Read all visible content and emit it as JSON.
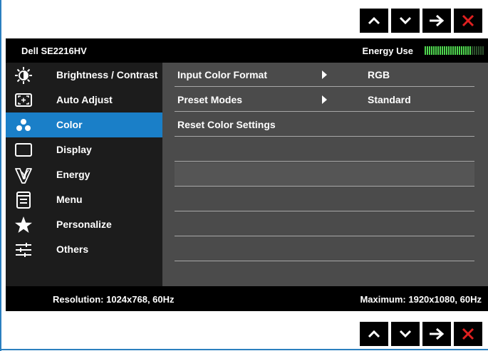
{
  "nav_buttons": {
    "up": "up-arrow-icon",
    "down": "down-arrow-icon",
    "enter": "right-arrow-icon",
    "exit": "close-icon",
    "exit_color": "#e02020"
  },
  "osd": {
    "model": "Dell SE2216HV",
    "energy_label": "Energy Use",
    "energy_level": 0.8,
    "energy_color": "#4fd64f",
    "energy_off_color": "#2c4f2c",
    "accent": "#1a7fc8",
    "menu": [
      {
        "label": "Brightness / Contrast",
        "icon": "brightness-icon"
      },
      {
        "label": "Auto Adjust",
        "icon": "auto-adjust-icon"
      },
      {
        "label": "Color",
        "icon": "color-icon",
        "active": true
      },
      {
        "label": "Display",
        "icon": "display-icon"
      },
      {
        "label": "Energy",
        "icon": "energy-icon"
      },
      {
        "label": "Menu",
        "icon": "menu-icon"
      },
      {
        "label": "Personalize",
        "icon": "star-icon"
      },
      {
        "label": "Others",
        "icon": "sliders-icon"
      }
    ],
    "options": [
      {
        "label": "Input Color Format",
        "value": "RGB",
        "has_submenu": true
      },
      {
        "label": "Preset Modes",
        "value": "Standard",
        "has_submenu": true
      },
      {
        "label": "Reset Color Settings",
        "value": "",
        "has_submenu": false
      },
      {
        "label": "",
        "value": "",
        "has_submenu": false
      },
      {
        "label": "",
        "value": "",
        "has_submenu": false
      },
      {
        "label": "",
        "value": "",
        "has_submenu": false
      },
      {
        "label": "",
        "value": "",
        "has_submenu": false
      },
      {
        "label": "",
        "value": "",
        "has_submenu": false
      }
    ],
    "footer": {
      "resolution": "Resolution: 1024x768, 60Hz",
      "maximum": "Maximum: 1920x1080, 60Hz"
    }
  }
}
